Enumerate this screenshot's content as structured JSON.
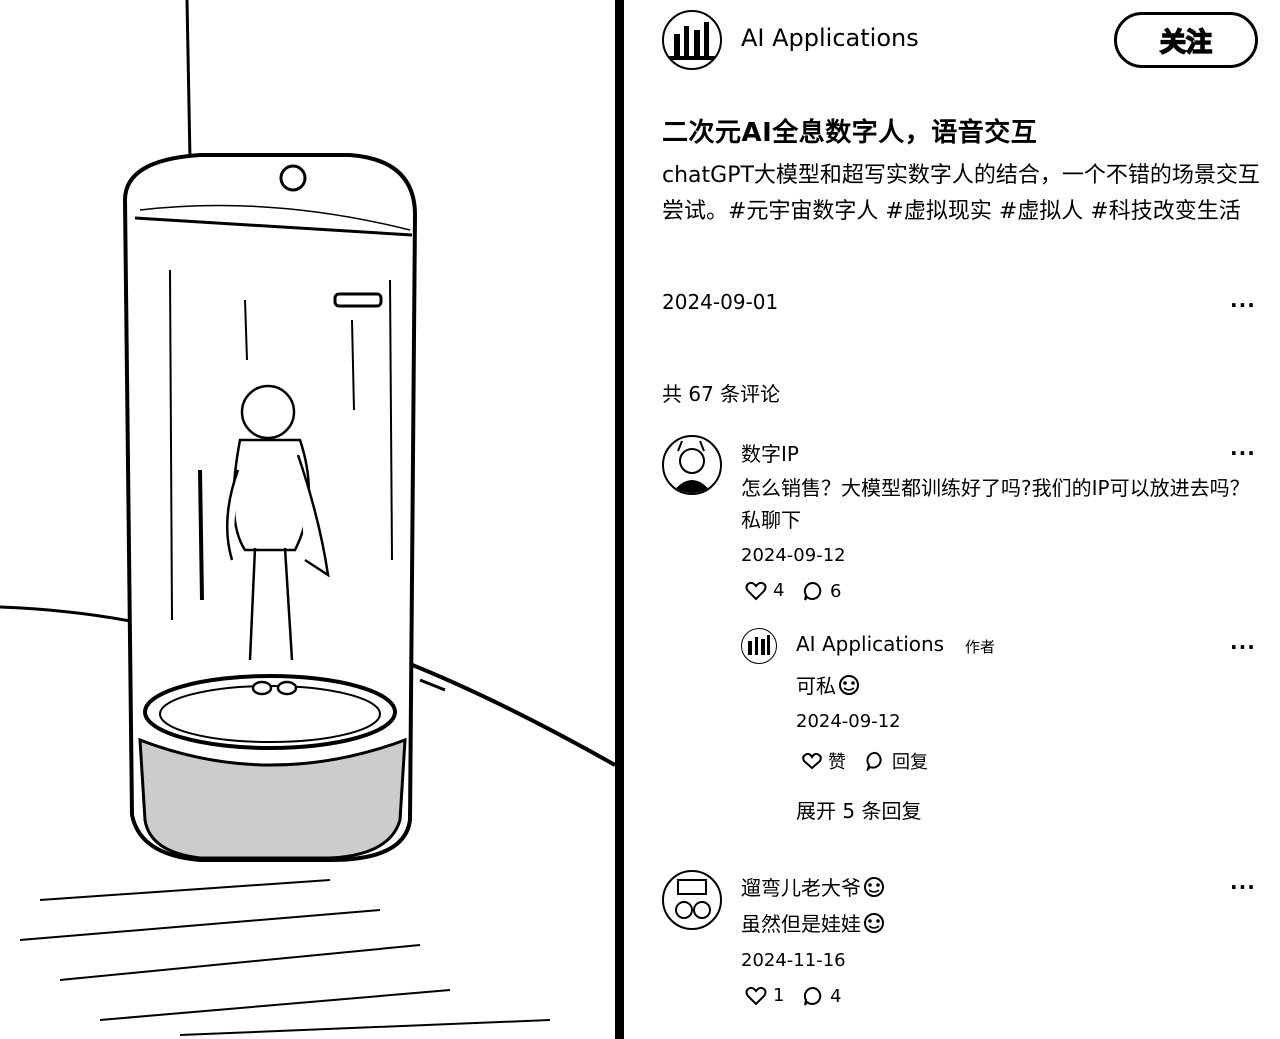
{
  "post": {
    "author": "AI Applications",
    "follow_label": "关注",
    "title": "二次元AI全息数字人，语音交互",
    "description": "chatGPT大模型和超写实数字人的结合，一个不错的场景交互尝试。#元宇宙数字人 #虚拟现实 #虚拟人 #科技改变生活",
    "date": "2024-09-01",
    "more": "···"
  },
  "comments_header": "共 67 条评论",
  "comments": [
    {
      "user": "数字IP",
      "text": "怎么销售？大模型都训练好了吗?我们的IP可以放进去吗？私聊下",
      "date": "2024-09-12",
      "likes": "4",
      "replies_count": "6",
      "more": "···",
      "reply": {
        "user": "AI Applications",
        "author_tag": "作者",
        "text": "可私",
        "date": "2024-09-12",
        "like_label": "赞",
        "reply_label": "回复",
        "more": "···"
      },
      "expand_label": "展开 5 条回复"
    },
    {
      "user": "遛弯儿老大爷",
      "text": "虽然但是娃娃",
      "date": "2024-11-16",
      "likes": "1",
      "replies_count": "4",
      "more": "···"
    }
  ],
  "icons": {
    "heart": "heart-icon",
    "comment": "comment-icon",
    "emoji": "emoji-icon"
  }
}
